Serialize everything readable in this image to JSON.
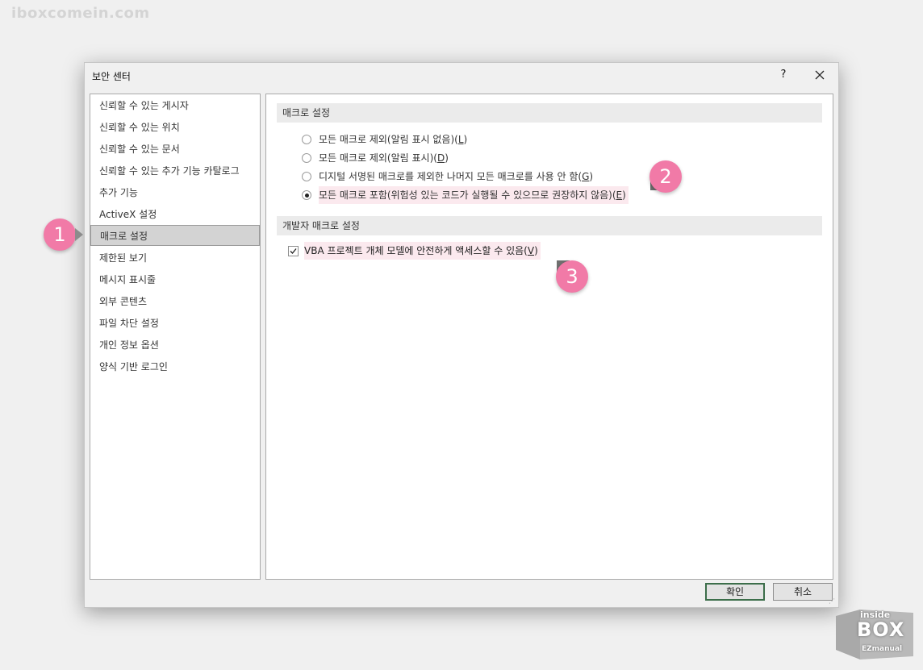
{
  "watermark": "iboxcomein.com",
  "dialog": {
    "title": "보안 센터",
    "help": "?"
  },
  "sidebar": {
    "items": [
      {
        "label": "신뢰할 수 있는 게시자"
      },
      {
        "label": "신뢰할 수 있는 위치"
      },
      {
        "label": "신뢰할 수 있는 문서"
      },
      {
        "label": "신뢰할 수 있는 추가 기능 카탈로그"
      },
      {
        "label": "추가 기능"
      },
      {
        "label": "ActiveX 설정"
      },
      {
        "label": "매크로 설정",
        "selected": true
      },
      {
        "label": "제한된 보기"
      },
      {
        "label": "메시지 표시줄"
      },
      {
        "label": "외부 콘텐츠"
      },
      {
        "label": "파일 차단 설정"
      },
      {
        "label": "개인 정보 옵션"
      },
      {
        "label": "양식 기반 로그인"
      }
    ]
  },
  "macro_settings": {
    "header": "매크로 설정",
    "options": [
      {
        "text": "모든 매크로 제외(알림 표시 없음)(",
        "key": "L",
        "end": ")",
        "checked": false
      },
      {
        "text": "모든 매크로 제외(알림 표시)(",
        "key": "D",
        "end": ")",
        "checked": false
      },
      {
        "text": "디지털 서명된 매크로를 제외한 나머지 모든 매크로를 사용 안 함(",
        "key": "G",
        "end": ")",
        "checked": false
      },
      {
        "text": "모든 매크로 포함(위험성 있는 코드가 실행될 수 있으므로 권장하지 않음)(",
        "key": "E",
        "end": ")",
        "checked": true
      }
    ]
  },
  "developer_settings": {
    "header": "개발자 매크로 설정",
    "vba_text": "VBA 프로젝트 개체 모델에 안전하게 액세스할 수 있음(",
    "vba_key": "V",
    "vba_end": ")",
    "vba_checked": true,
    "check_mark": "✓"
  },
  "buttons": {
    "ok": "확인",
    "cancel": "취소"
  },
  "badges": [
    "1",
    "2",
    "3"
  ],
  "logo": {
    "line1": "inside",
    "line2": "BOX",
    "line3": "EZmanual"
  },
  "colors": {
    "badge": "#f17aa7",
    "highlight": "#fbe9ee",
    "ok_border": "#3c6e4a"
  }
}
